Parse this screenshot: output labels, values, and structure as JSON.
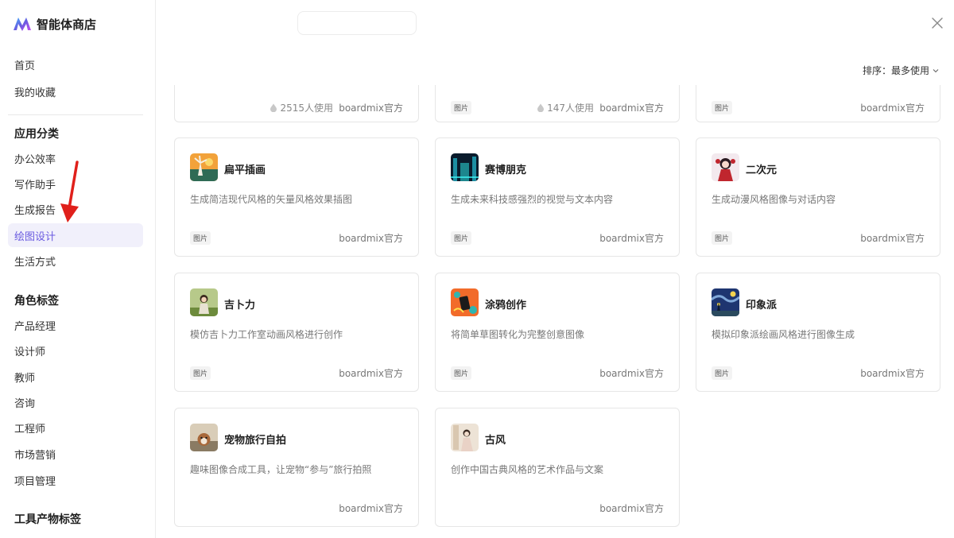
{
  "app": {
    "title": "智能体商店"
  },
  "sidebar": {
    "top_items": [
      {
        "label": "首页"
      },
      {
        "label": "我的收藏"
      }
    ],
    "category_heading": "应用分类",
    "category_items": [
      {
        "label": "办公效率"
      },
      {
        "label": "写作助手"
      },
      {
        "label": "生成报告"
      },
      {
        "label": "绘图设计",
        "active": true
      },
      {
        "label": "生活方式"
      }
    ],
    "role_heading": "角色标签",
    "role_items": [
      {
        "label": "产品经理"
      },
      {
        "label": "设计师"
      },
      {
        "label": "教师"
      },
      {
        "label": "咨询"
      },
      {
        "label": "工程师"
      },
      {
        "label": "市场营销"
      },
      {
        "label": "项目管理"
      }
    ],
    "tool_heading": "工具产物标签"
  },
  "toolbar": {
    "sort_label": "排序：最多使用"
  },
  "partial_cards": [
    {
      "usage": "2515人使用",
      "author": "boardmix官方",
      "tag": ""
    },
    {
      "usage": "147人使用",
      "author": "boardmix官方",
      "tag": "图片"
    },
    {
      "usage": "",
      "author": "boardmix官方",
      "tag": "图片"
    }
  ],
  "cards": [
    {
      "name": "扁平插画",
      "desc": "生成简洁现代风格的矢量风格效果插图",
      "tag": "图片",
      "author": "boardmix官方"
    },
    {
      "name": "赛博朋克",
      "desc": "生成未来科技感强烈的视觉与文本内容",
      "tag": "图片",
      "author": "boardmix官方"
    },
    {
      "name": "二次元",
      "desc": "生成动漫风格图像与对话内容",
      "tag": "图片",
      "author": "boardmix官方"
    },
    {
      "name": "吉卜力",
      "desc": "模仿吉卜力工作室动画风格进行创作",
      "tag": "图片",
      "author": "boardmix官方"
    },
    {
      "name": "涂鸦创作",
      "desc": "将简单草图转化为完整创意图像",
      "tag": "图片",
      "author": "boardmix官方"
    },
    {
      "name": "印象派",
      "desc": "模拟印象派绘画风格进行图像生成",
      "tag": "图片",
      "author": "boardmix官方"
    },
    {
      "name": "宠物旅行自拍",
      "desc": "趣味图像合成工具，让宠物“参与”旅行拍照",
      "tag": "",
      "author": "boardmix官方"
    },
    {
      "name": "古风",
      "desc": "创作中国古典风格的艺术作品与文案",
      "tag": "",
      "author": "boardmix官方"
    }
  ],
  "colors": {
    "accent": "#6a5be0",
    "active_bg": "#f1f0fb",
    "annotation_arrow": "#e0201b"
  }
}
